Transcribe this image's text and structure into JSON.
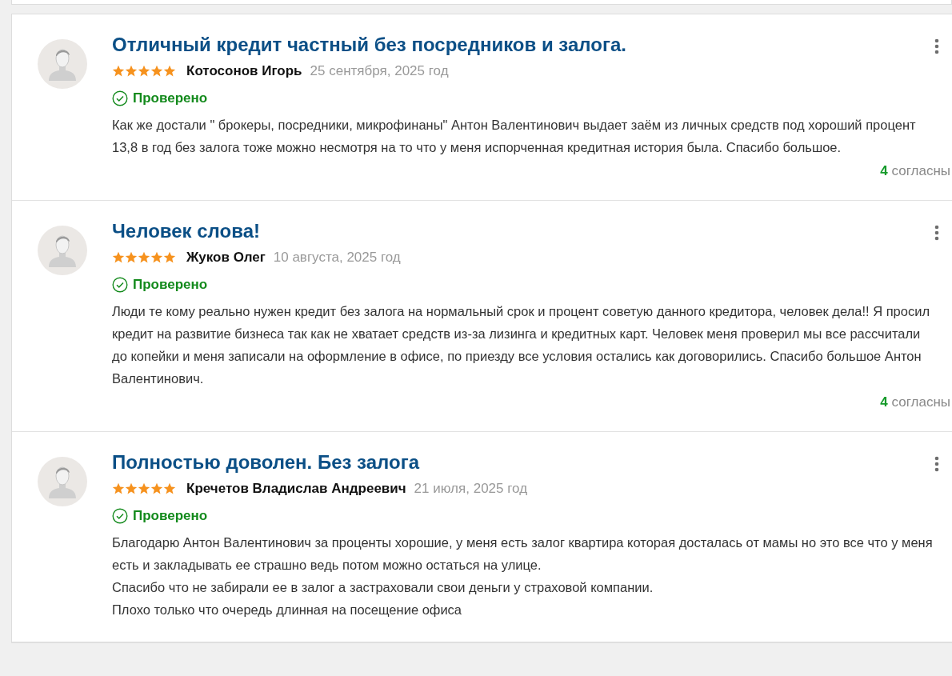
{
  "reviews": [
    {
      "title": "Отличный кредит частный без посредников и залога.",
      "stars": 5,
      "author": "Котосонов Игорь",
      "date": "25 сентября, 2025 год",
      "verified": true,
      "verified_label": "Проверено",
      "paragraphs": [
        "Как же достали \" брокеры, посредники, микрофинаны\" Антон Валентинович выдает заём из личных средств под хороший процент 13,8 в год без залога тоже можно несмотря на то что у меня испорченная кредитная история была. Спасибо большое."
      ],
      "agree_count": "4",
      "agree_label": "согласны"
    },
    {
      "title": "Человек слова!",
      "stars": 5,
      "author": "Жуков Олег",
      "date": "10 августа, 2025 год",
      "verified": true,
      "verified_label": "Проверено",
      "paragraphs": [
        "Люди те кому реально нужен кредит без залога на нормальный срок и процент советую данного кредитора, человек дела!! Я просил кредит на развитие бизнеса так как не хватает средств из-за лизинга и кредитных карт. Человек меня проверил мы все рассчитали до копейки и меня записали на оформление в офисе, по приезду все условия остались как договорились. Спасибо большое Антон Валентинович."
      ],
      "agree_count": "4",
      "agree_label": "согласны"
    },
    {
      "title": "Полностью доволен. Без залога",
      "stars": 5,
      "author": "Кречетов Владислав Андреевич",
      "date": "21 июля, 2025 год",
      "verified": true,
      "verified_label": "Проверено",
      "paragraphs": [
        "Благодарю Антон Валентинович за проценты хорошие, у меня есть залог квартира которая досталась от мамы но это все что у меня есть и закладывать ее страшно ведь потом можно остаться на улице.",
        "Спасибо что не забирали ее в залог а застраховали свои деньги у страховой компании.",
        "Плохо только что очередь длинная на посещение офиса"
      ]
    }
  ]
}
